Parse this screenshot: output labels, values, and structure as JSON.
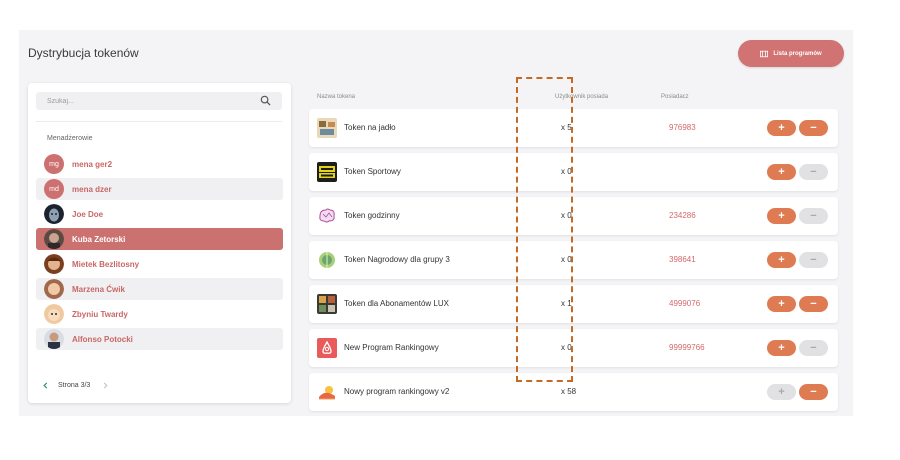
{
  "header": {
    "title": "Dystrybucja tokenów",
    "programs_button": "Lista programów"
  },
  "search": {
    "placeholder": "Szukaj..."
  },
  "managers": {
    "label": "Menadżerowie",
    "items": [
      {
        "name": "mena ger2",
        "initials": "mg",
        "avatar": "initials"
      },
      {
        "name": "mena dzer",
        "initials": "md",
        "avatar": "initials"
      },
      {
        "name": "Joe Doe",
        "avatar": "photo"
      },
      {
        "name": "Kuba Zetorski",
        "avatar": "photo",
        "active": true
      },
      {
        "name": "Mietek Bezlitosny",
        "avatar": "photo"
      },
      {
        "name": "Marzena Ćwik",
        "avatar": "photo"
      },
      {
        "name": "Zbyniu Twardy",
        "avatar": "photo"
      },
      {
        "name": "Alfonso Potocki",
        "avatar": "photo"
      }
    ]
  },
  "pagination": {
    "label": "Strona 3/3"
  },
  "table": {
    "headers": {
      "name": "Nazwa tokena",
      "count": "Użytkownik posiada",
      "owner": "Posiadacz"
    },
    "rows": [
      {
        "name": "Token na jadło",
        "count": "x 5",
        "owner": "976983",
        "icon": "food-token-icon"
      },
      {
        "name": "Token Sportowy",
        "count": "x 0",
        "owner": "",
        "icon": "best-gym-icon"
      },
      {
        "name": "Token godzinny",
        "count": "x 0",
        "owner": "234286",
        "icon": "brain-icon"
      },
      {
        "name": "Token Nagrodowy dla grupy 3",
        "count": "x 0",
        "owner": "398641",
        "icon": "nature-icon"
      },
      {
        "name": "Token dla Abonamentów LUX",
        "count": "x 1",
        "owner": "4999076",
        "icon": "lux-icon"
      },
      {
        "name": "New Program Rankingowy",
        "count": "x 0",
        "owner": "99999766",
        "icon": "airbnb-icon"
      },
      {
        "name": "Nowy program rankingowy v2",
        "count": "x 58",
        "owner": "",
        "icon": "sun-icon"
      }
    ]
  },
  "button_states": [
    {
      "plus": "on",
      "minus": "on"
    },
    {
      "plus": "on",
      "minus": "off"
    },
    {
      "plus": "on",
      "minus": "off"
    },
    {
      "plus": "on",
      "minus": "off"
    },
    {
      "plus": "on",
      "minus": "on"
    },
    {
      "plus": "on",
      "minus": "off"
    },
    {
      "plus": "off",
      "minus": "on"
    }
  ],
  "colors": {
    "accent": "#d07372",
    "button_on": "#df7b52",
    "button_off": "#e1e1e3",
    "owner_text": "#d26a69",
    "highlight": "#c56a25"
  }
}
